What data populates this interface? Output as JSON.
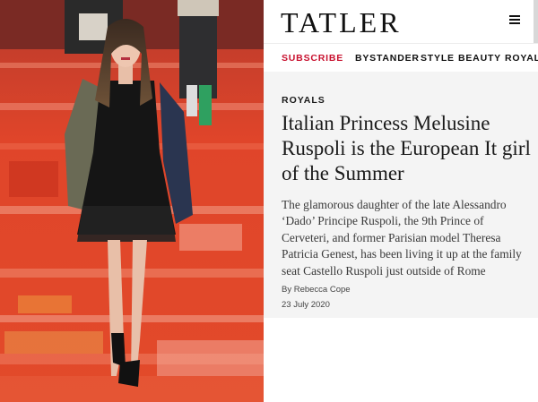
{
  "site": {
    "logo_text": "TATLER"
  },
  "header": {
    "menu_icon": "hamburger-menu-icon"
  },
  "nav": {
    "items": [
      {
        "label": "SUBSCRIBE",
        "highlight": true
      },
      {
        "label": "BYSTANDER"
      },
      {
        "label": "STYLE"
      },
      {
        "label": "BEAUTY"
      },
      {
        "label": "ROYAL"
      }
    ]
  },
  "article": {
    "category": "ROYALS",
    "headline": "Italian Princess Melusine Ruspoli is the European It girl of the Summer",
    "standfirst": "The glamorous daughter of the late Alessandro ‘Dado’ Principe Ruspoli, the 9th Prince of Cerveteri, and former Parisian model Theresa Patricia Genest, has been living it up at the family seat Castello Ruspoli just outside of Rome",
    "byline": "By Rebecca Cope",
    "date": "23 July 2020"
  },
  "colors": {
    "accent": "#c8102e",
    "text": "#1a1a1a",
    "article_bg": "#f4f4f4",
    "runway_red": "#d8361c"
  }
}
